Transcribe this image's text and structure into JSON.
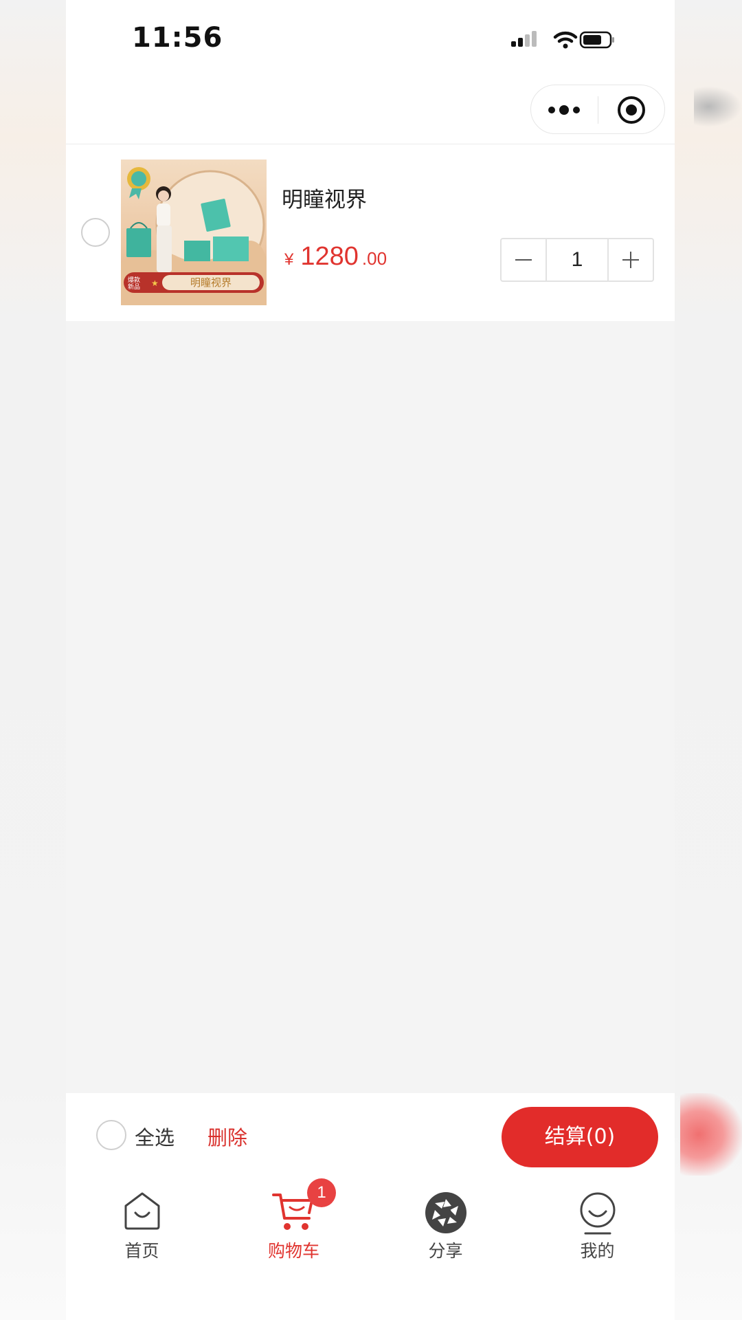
{
  "status_bar": {
    "time": "11:56"
  },
  "cart": {
    "items": [
      {
        "title": "明瞳视界",
        "price_symbol": "¥",
        "price_integer": "1280",
        "price_decimal": ".00",
        "quantity": "1",
        "thumbnail_badge": "爆款\n新品",
        "thumbnail_banner": "明瞳视界"
      }
    ]
  },
  "footer": {
    "select_all_label": "全选",
    "delete_label": "删除",
    "checkout_label": "结算(0)"
  },
  "tabbar": {
    "tabs": [
      {
        "label": "首页",
        "icon": "home-icon"
      },
      {
        "label": "购物车",
        "icon": "cart-icon",
        "badge": "1",
        "active": true
      },
      {
        "label": "分享",
        "icon": "share-aperture-icon"
      },
      {
        "label": "我的",
        "icon": "profile-icon"
      }
    ]
  },
  "colors": {
    "accent_red": "#e22c2a",
    "price_red": "#e0342f",
    "page_background": "#f4f4f4"
  }
}
